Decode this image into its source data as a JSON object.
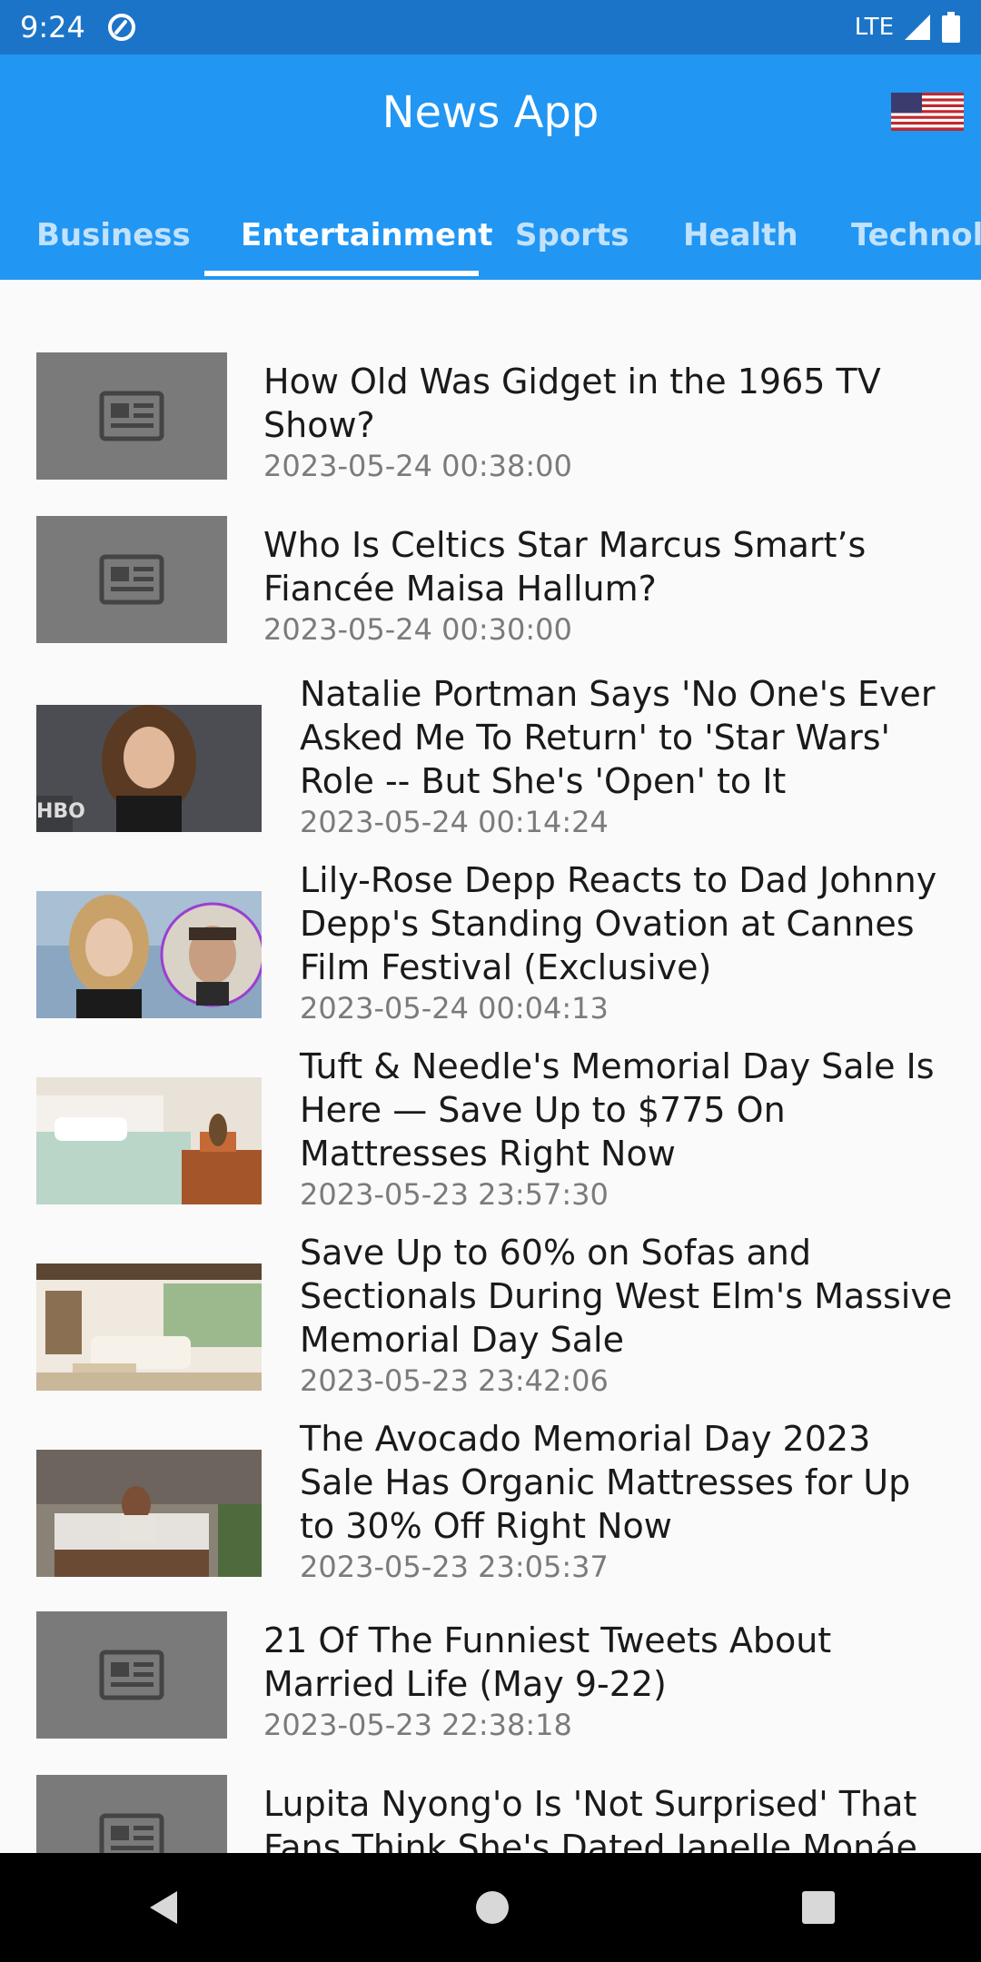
{
  "status_bar": {
    "time": "9:24",
    "network": "LTE"
  },
  "app_bar": {
    "title": "News App",
    "country_flag": "us-flag-icon"
  },
  "tabs": [
    {
      "label": "Business",
      "active": false
    },
    {
      "label": "Entertainment",
      "active": true
    },
    {
      "label": "Sports",
      "active": false
    },
    {
      "label": "Health",
      "active": false
    },
    {
      "label": "Technolo",
      "active": false
    }
  ],
  "articles": [
    {
      "title": "How Old Was Gidget in the 1965 TV Show?",
      "date": "2023-05-24 00:38:00",
      "image": "placeholder-news-icon"
    },
    {
      "title": "Who Is Celtics Star Marcus Smart’s Fiancée Maisa Hallum?",
      "date": "2023-05-24 00:30:00",
      "image": "placeholder-news-icon"
    },
    {
      "title": "Natalie Portman Says 'No One's Ever Asked Me To Return' to 'Star Wars' Role -- But She's 'Open' to It",
      "date": "2023-05-24 00:14:24",
      "image": "photo"
    },
    {
      "title": "Lily-Rose Depp Reacts to Dad Johnny Depp's Standing Ovation at Cannes Film Festival (Exclusive)",
      "date": "2023-05-24 00:04:13",
      "image": "photo"
    },
    {
      "title": "Tuft & Needle's Memorial Day Sale Is Here — Save Up to $775 On Mattresses Right Now",
      "date": "2023-05-23 23:57:30",
      "image": "photo"
    },
    {
      "title": "Save Up to 60% on Sofas and Sectionals During West Elm's Massive Memorial Day Sale",
      "date": "2023-05-23 23:42:06",
      "image": "photo"
    },
    {
      "title": "The Avocado Memorial Day 2023 Sale Has Organic Mattresses for Up to 30% Off Right Now",
      "date": "2023-05-23 23:05:37",
      "image": "photo"
    },
    {
      "title": "21 Of The Funniest Tweets About Married Life (May 9-22)",
      "date": "2023-05-23 22:38:18",
      "image": "placeholder-news-icon"
    },
    {
      "title": "Lupita Nyong'o Is 'Not Surprised' That Fans Think She's Dated Janelle Monáe",
      "date": "",
      "image": "placeholder-news-icon"
    }
  ],
  "nav_bar": {
    "back": "back-triangle-icon",
    "home": "home-circle-icon",
    "recents": "recents-square-icon"
  }
}
